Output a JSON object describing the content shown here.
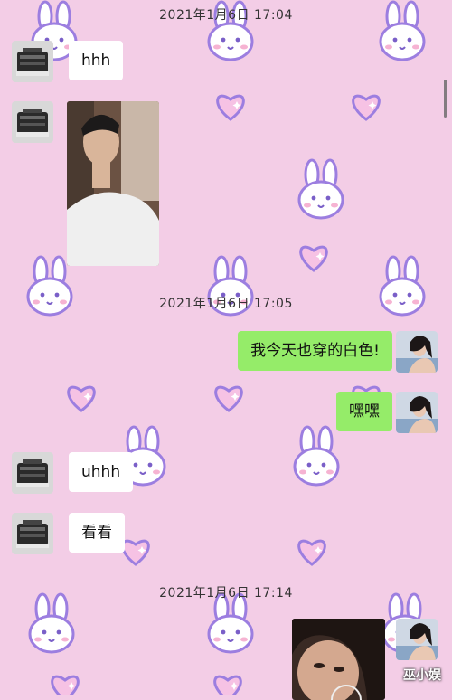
{
  "timestamps": [
    "2021年1月6日 17:04",
    "2021年1月6日 17:05",
    "2021年1月6日 17:14"
  ],
  "messages": {
    "m1": "hhh",
    "m3": "我今天也穿的白色!",
    "m4": "嘿嘿",
    "m5": "uhhh",
    "m6": "看看"
  },
  "watermark": "巫小娱",
  "colors": {
    "background": "#f3cde6",
    "outgoing_bubble": "#95ec69",
    "incoming_bubble": "#ffffff",
    "pattern_outline": "#9c7ee0"
  },
  "icons": {
    "pattern_left": "bunny-sticker-icon",
    "pattern_right": "heart-sticker-icon"
  }
}
